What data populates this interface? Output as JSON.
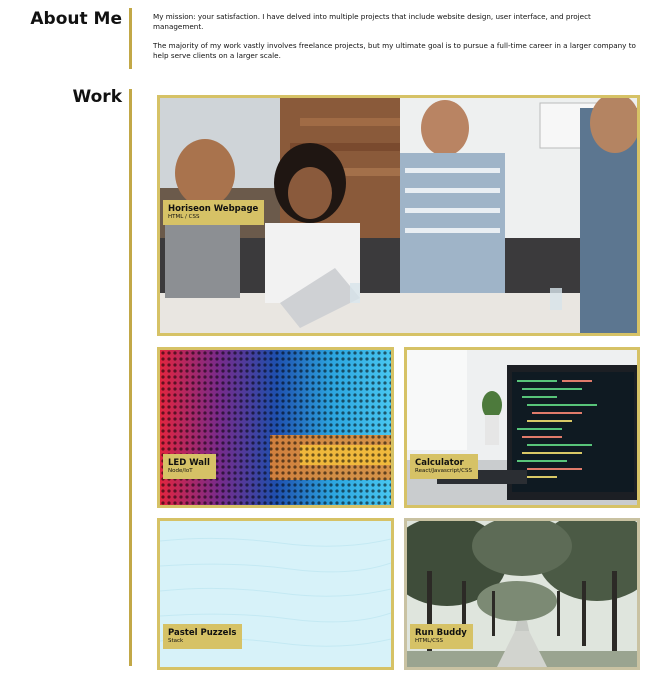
{
  "about": {
    "heading": "About Me",
    "paragraph_1": "My mission: your satisfaction. I have delved into multiple projects that include website design, user interface, and project management.",
    "paragraph_2": "The majority of my work vastly involves freelance projects, but my ultimate goal is to pursue a full-time career in a larger company to help serve clients on a larger scale."
  },
  "work": {
    "heading": "Work",
    "projects": [
      {
        "title": "Horiseon Webpage",
        "tech": "HTML / CSS",
        "image": "team-meeting-photo"
      },
      {
        "title": "LED Wall",
        "tech": "Node/IoT",
        "image": "led-lights-photo"
      },
      {
        "title": "Calculator",
        "tech": "React/Javascript/CSS",
        "image": "code-monitor-photo"
      },
      {
        "title": "Pastel Puzzels",
        "tech": "Stack",
        "image": "pastel-blue-texture"
      },
      {
        "title": "Run Buddy",
        "tech": "HTML/CSS",
        "image": "tree-lined-path-photo"
      }
    ]
  },
  "colors": {
    "accent": "#c2a847",
    "label_background": "#d6c266",
    "text": "#111111",
    "background": "#ffffff"
  }
}
